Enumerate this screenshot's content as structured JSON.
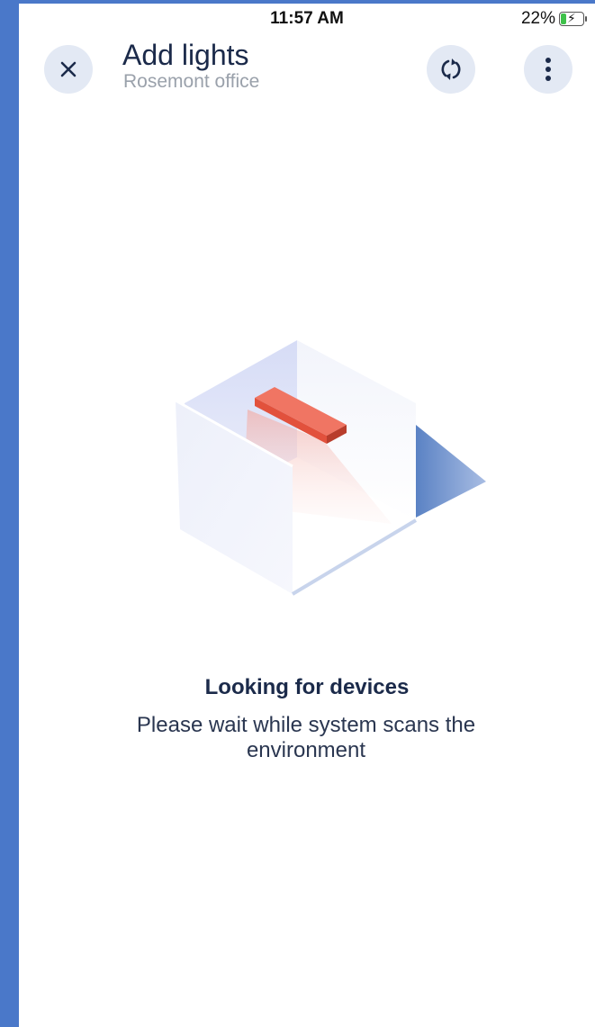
{
  "status": {
    "time": "11:57 AM",
    "battery": "22%"
  },
  "header": {
    "title": "Add lights",
    "subtitle": "Rosemont office"
  },
  "icons": {
    "close": "close-icon",
    "sync": "sync-icon",
    "more": "more-vertical-icon",
    "battery": "battery-charging-icon"
  },
  "message": {
    "title": "Looking for devices",
    "body": "Please wait while system scans the environment"
  },
  "colors": {
    "accent_strip": "#4a78c9",
    "button_bg": "#e3e9f4",
    "title_text": "#1b2a4a",
    "subtitle_text": "#9aa1ab",
    "light_bar": "#e8604c"
  }
}
